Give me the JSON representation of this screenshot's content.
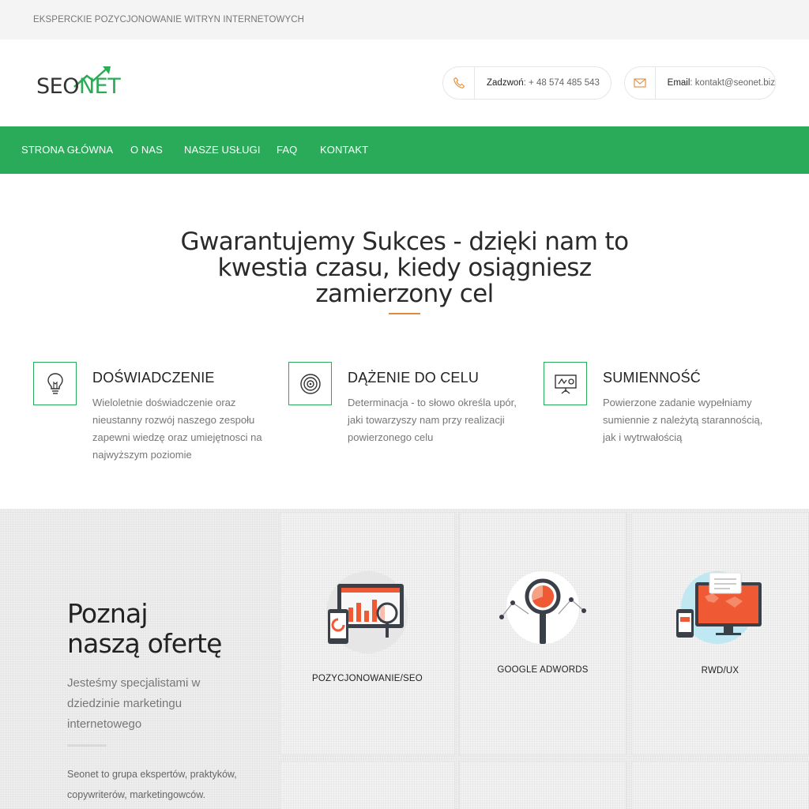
{
  "topbar": {
    "tagline": "EKSPERCKIE POZYCJONOWANIE WITRYN INTERNETOWYCH"
  },
  "logo": {
    "part1": "SEO",
    "part2": "NET"
  },
  "contact": {
    "phone_label": "Zadzwoń",
    "phone_value": ": + 48 574 485 543",
    "email_label": "Email",
    "email_value": ": kontakt@seonet.biz"
  },
  "nav": {
    "items": [
      "STRONA GŁÓWNA",
      "O NAS",
      "NASZE USŁUGI",
      "FAQ",
      "KONTAKT"
    ]
  },
  "hero": {
    "title_line1": "Gwarantujemy Sukces - dzięki nam to",
    "title_line2": "kwestia czasu, kiedy osiągniesz",
    "title_line3": "zamierzony cel"
  },
  "features": [
    {
      "title": "DOŚWIADCZENIE",
      "desc": "Wieloletnie doświadczenie oraz nieustanny rozwój naszego zespołu zapewni wiedzę oraz umiejętnosci na najwyższym poziomie",
      "icon": "lightbulb-icon"
    },
    {
      "title": "DĄŻENIE DO CELU",
      "desc": "Determinacja - to słowo określa upór, jaki towarzyszy nam przy realizacji powierzonego celu",
      "icon": "target-icon"
    },
    {
      "title": "SUMIENNOŚĆ",
      "desc": "Powierzone zadanie wypełniamy sumiennie z należytą starannością, jak i wytrwałością",
      "icon": "presentation-board-icon"
    }
  ],
  "offer": {
    "title_line1": "Poznaj",
    "title_line2": "naszą ofertę",
    "subtitle": "Jesteśmy specjalistami w dziedzinie marketingu internetowego",
    "body": "Seonet to grupa ekspertów, praktyków, copywriterów, marketingowców."
  },
  "services": [
    {
      "label": "POZYCJONOWANIE/SEO",
      "icon": "seo-devices-icon"
    },
    {
      "label": "GOOGLE ADWORDS",
      "icon": "magnifier-chart-icon"
    },
    {
      "label": "RWD/UX",
      "icon": "responsive-devices-icon"
    }
  ],
  "colors": {
    "brand_green": "#2aab5a",
    "accent_orange": "#e08a3c"
  }
}
